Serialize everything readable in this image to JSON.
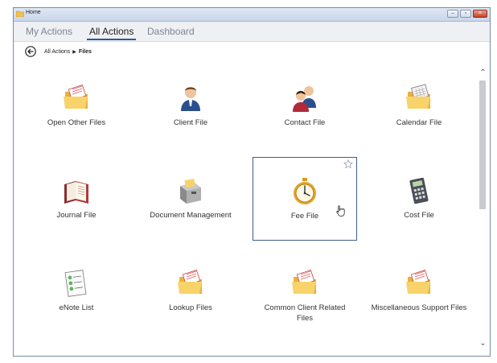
{
  "window": {
    "title": "Home"
  },
  "tabs": [
    {
      "label": "My Actions",
      "active": false
    },
    {
      "label": "All Actions",
      "active": true
    },
    {
      "label": "Dashboard",
      "active": false
    }
  ],
  "breadcrumb": {
    "parent": "All Actions",
    "current": "Files"
  },
  "tiles": [
    {
      "label": "Open Other Files",
      "icon": "folder-icon"
    },
    {
      "label": "Client File",
      "icon": "person-icon"
    },
    {
      "label": "Contact File",
      "icon": "people-icon"
    },
    {
      "label": "Calendar File",
      "icon": "calendar-folder-icon"
    },
    {
      "label": "Journal File",
      "icon": "book-icon"
    },
    {
      "label": "Document Management",
      "icon": "file-cabinet-icon"
    },
    {
      "label": "Fee File",
      "icon": "stopwatch-icon",
      "selected": true
    },
    {
      "label": "Cost File",
      "icon": "calculator-icon"
    },
    {
      "label": "eNote List",
      "icon": "checklist-icon"
    },
    {
      "label": "Lookup Files",
      "icon": "folder-icon"
    },
    {
      "label": "Common Client Related Files",
      "icon": "folder-icon"
    },
    {
      "label": "Miscellaneous Support Files",
      "icon": "folder-icon"
    }
  ],
  "colors": {
    "accent": "#2c5aa0",
    "selection_border": "#3e5f8a",
    "folder": "#f2c14e"
  }
}
